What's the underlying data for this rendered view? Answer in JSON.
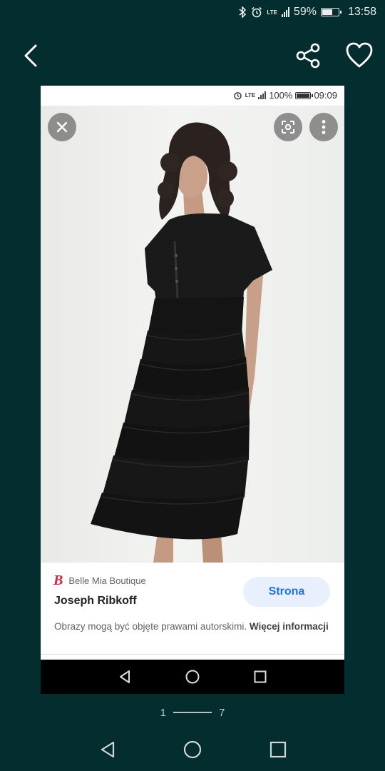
{
  "status_bar": {
    "battery": "59%",
    "time": "13:58",
    "network": "LTE",
    "battery_level": 0.59
  },
  "toolbar": {
    "back_icon": "chevron-left-icon",
    "share_icon": "share-icon",
    "favorite_icon": "heart-outline-icon"
  },
  "inner_screen": {
    "status_bar": {
      "battery": "100%",
      "time": "09:09",
      "network": "LTE",
      "battery_level": 1.0
    },
    "viewer": {
      "close_icon": "close-icon",
      "lens_icon": "lens-icon",
      "more_icon": "more-vert-icon"
    },
    "result_card": {
      "source_name": "Belle Mia Boutique",
      "source_logo_letter": "B",
      "title": "Joseph Ribkoff",
      "visit_button": "Strona",
      "copyright_text": "Obrazy mogą być objęte prawami autorskimi.",
      "more_info_link": "Więcej informacji"
    }
  },
  "pager": {
    "current": "1",
    "total": "7"
  },
  "colors": {
    "background": "#032d2f",
    "accent": "#1a73e8",
    "button_bg": "#e8f0fe",
    "brand_logo": "#d0243a"
  }
}
